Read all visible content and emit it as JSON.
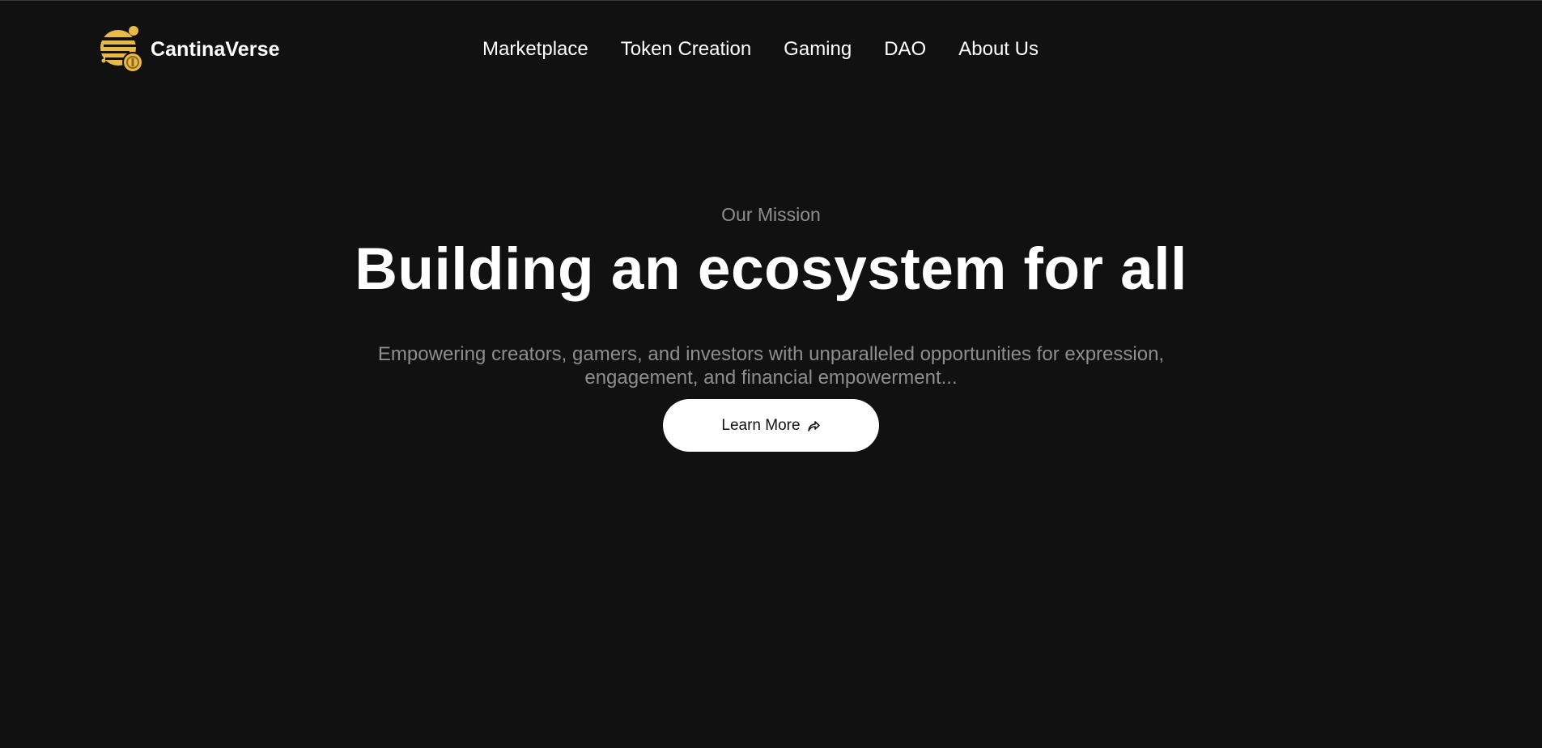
{
  "brand": {
    "name": "CantinaVerse",
    "logo_icon": "cantinaverse-coin-logo",
    "accent_color": "#e9b949"
  },
  "nav": {
    "items": [
      {
        "label": "Marketplace"
      },
      {
        "label": "Token Creation"
      },
      {
        "label": "Gaming"
      },
      {
        "label": "DAO"
      },
      {
        "label": "About Us"
      }
    ]
  },
  "hero": {
    "eyebrow": "Our Mission",
    "headline": "Building an ecosystem for all",
    "subtext": "Empowering creators, gamers, and investors with unparalleled opportunities for expression, engagement, and financial empowerment...",
    "cta_label": "Learn More",
    "cta_icon": "share-arrow-icon"
  },
  "colors": {
    "background": "#111111",
    "text_primary": "#ffffff",
    "text_muted": "#8e8e8e",
    "button_bg": "#ffffff"
  }
}
